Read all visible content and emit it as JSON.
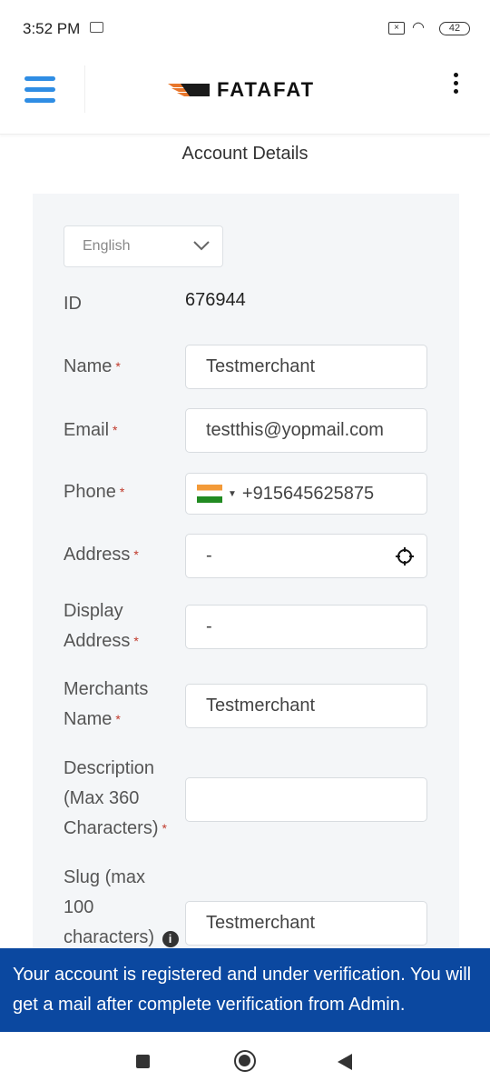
{
  "status_bar": {
    "time": "3:52 PM",
    "battery": "42"
  },
  "header": {
    "logo": "FATAFAT"
  },
  "page_title": "Account Details",
  "language": {
    "selected": "English"
  },
  "form": {
    "id": {
      "label": "ID",
      "value": "676944"
    },
    "name": {
      "label": "Name",
      "value": "Testmerchant"
    },
    "email": {
      "label": "Email",
      "value": "testthis@yopmail.com"
    },
    "phone": {
      "label": "Phone",
      "value": "+915645625875"
    },
    "address": {
      "label": "Address",
      "value": "-"
    },
    "display_address": {
      "label1": "Display",
      "label2": "Address",
      "value": "-"
    },
    "merchants_name": {
      "label1": "Merchants",
      "label2": "Name",
      "value": "Testmerchant"
    },
    "description": {
      "label1": "Description",
      "label2": "(Max 360",
      "label3": "Characters)",
      "value": ""
    },
    "slug": {
      "label1": "Slug (max",
      "label2": "100",
      "label3": "characters)",
      "value": "Testmerchant"
    },
    "required_mark": "*"
  },
  "banner": {
    "message": "Your account is registered and under verification. You will get a mail after complete verification from Admin."
  },
  "colors": {
    "accent": "#2f8de4",
    "banner": "#0b48a0",
    "required": "#c0392b"
  }
}
